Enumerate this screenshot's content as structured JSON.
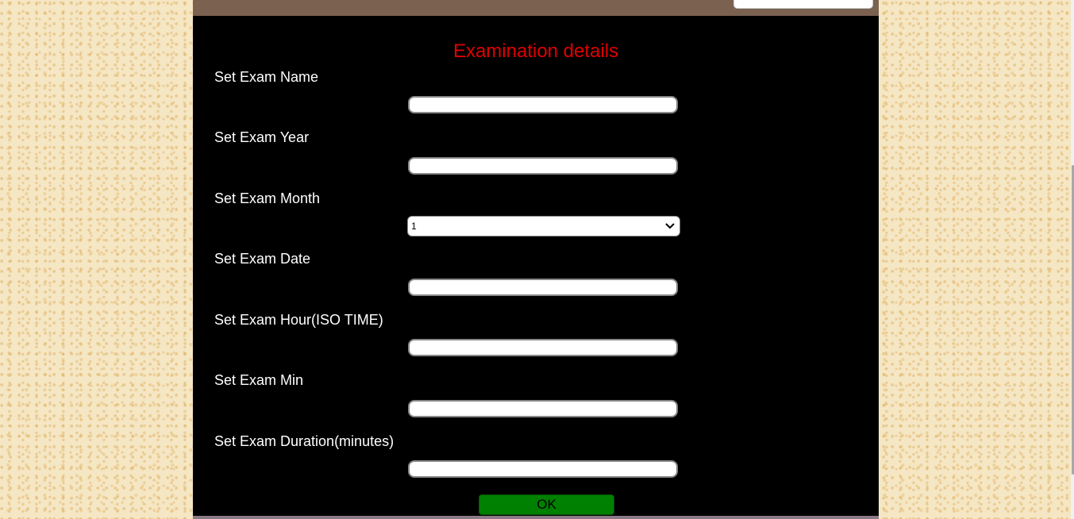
{
  "form": {
    "title": "Examination details",
    "fields": [
      {
        "label": "Set Exam Name",
        "value": ""
      },
      {
        "label": "Set Exam Year",
        "value": ""
      },
      {
        "label": "Set Exam Month",
        "selected": "1"
      },
      {
        "label": "Set Exam Date",
        "value": ""
      },
      {
        "label": "Set Exam Hour(ISO TIME)",
        "value": ""
      },
      {
        "label": "Set Exam Min",
        "value": ""
      },
      {
        "label": "Set Exam Duration(minutes)",
        "value": ""
      }
    ],
    "submit_label": "OK"
  },
  "colors": {
    "page_background": "#f5e6c4",
    "panel_background": "#000000",
    "header_bar": "#7a6150",
    "title": "#e00000",
    "ok_button": "#008000"
  }
}
